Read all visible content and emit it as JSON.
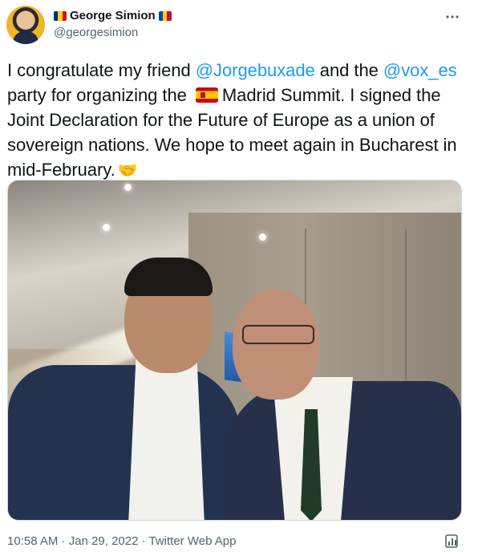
{
  "author": {
    "name": "George Simion",
    "handle": "@georgesimion",
    "flag_left": [
      "#002b7f",
      "#fcd116",
      "#ce1126"
    ],
    "flag_right": [
      "#0046ae",
      "#ffd200",
      "#cc092f"
    ]
  },
  "tweet": {
    "part1": "I congratulate my friend ",
    "mention1": "@Jorgebuxade",
    "part2": " and the ",
    "mention2": "@vox_es",
    "part3": " party for organizing the ",
    "part4": "Madrid Summit. I signed the Joint Declaration for the Future of Europe as a union of sovereign nations. We hope to meet again in Bucharest in mid-February.",
    "emoji": "🤝"
  },
  "meta": {
    "timestamp": "10:58 AM · Jan 29, 2022 · Twitter Web App"
  },
  "icons": {
    "more": "more-icon",
    "analytics": "analytics-icon"
  },
  "colors": {
    "link": "#1d9bf0",
    "secondary": "#536471"
  }
}
